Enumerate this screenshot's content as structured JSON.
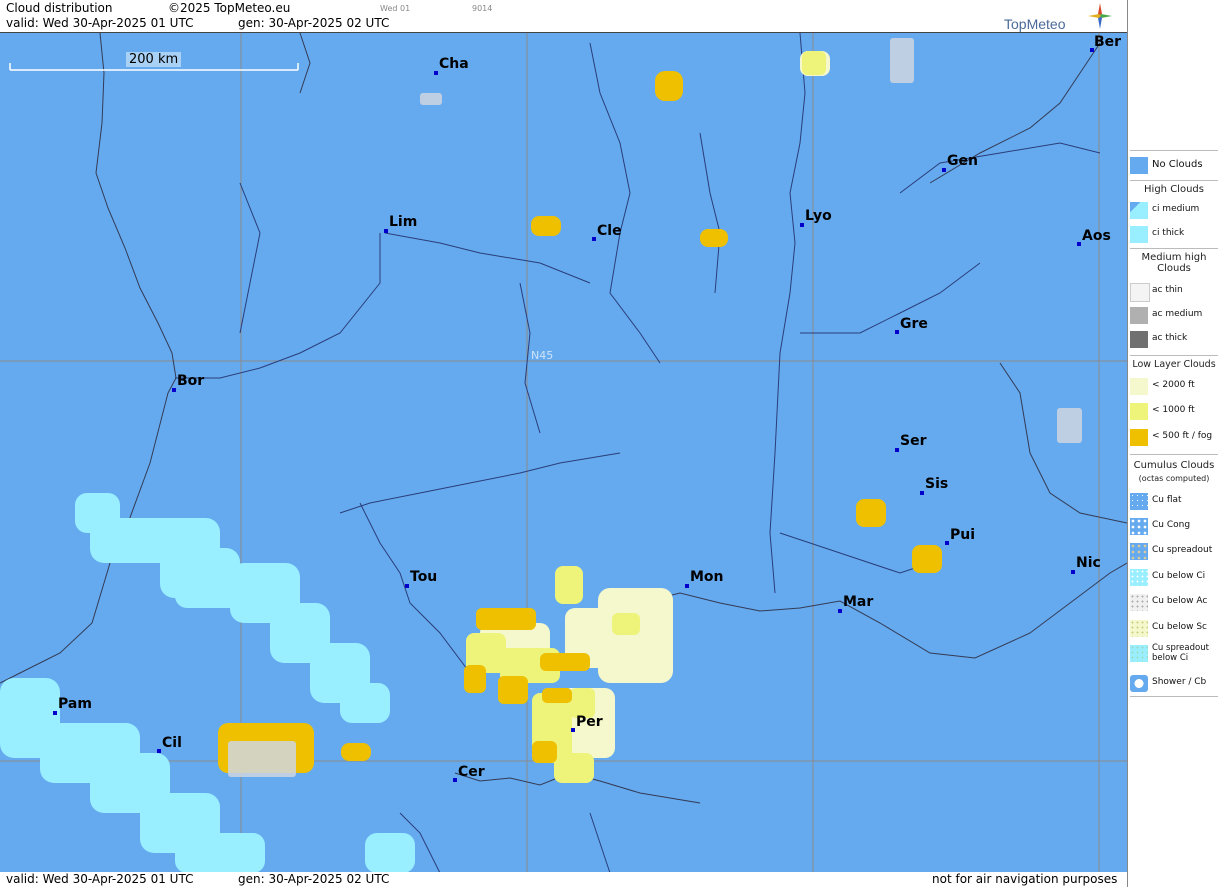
{
  "header": {
    "title": "Cloud distribution",
    "copyright": "©2025 TopMeteo.eu",
    "valid": "valid:  Wed  30-Apr-2025  01 UTC",
    "gen": "gen: 30-Apr-2025 02 UTC",
    "run_small": "Wed 01",
    "code_small": "9014",
    "logo": "TopMeteo"
  },
  "map": {
    "scale_label": "200 km",
    "lat_label": "N45",
    "cities": [
      {
        "id": "cha",
        "name": "Cha"
      },
      {
        "id": "ber",
        "name": "Ber"
      },
      {
        "id": "gen",
        "name": "Gen"
      },
      {
        "id": "lim",
        "name": "Lim"
      },
      {
        "id": "cle",
        "name": "Cle"
      },
      {
        "id": "lyo",
        "name": "Lyo"
      },
      {
        "id": "aos",
        "name": "Aos"
      },
      {
        "id": "gre",
        "name": "Gre"
      },
      {
        "id": "bor",
        "name": "Bor"
      },
      {
        "id": "ser",
        "name": "Ser"
      },
      {
        "id": "sis",
        "name": "Sis"
      },
      {
        "id": "pui",
        "name": "Pui"
      },
      {
        "id": "tou",
        "name": "Tou"
      },
      {
        "id": "mon",
        "name": "Mon"
      },
      {
        "id": "nic",
        "name": "Nic"
      },
      {
        "id": "mar",
        "name": "Mar"
      },
      {
        "id": "pam",
        "name": "Pam"
      },
      {
        "id": "per",
        "name": "Per"
      },
      {
        "id": "cil",
        "name": "Cil"
      },
      {
        "id": "cer",
        "name": "Cer"
      }
    ]
  },
  "footer": {
    "valid": "valid:  Wed  30-Apr-2025  01 UTC",
    "gen": "gen: 30-Apr-2025 02 UTC",
    "disclaimer": "not for air navigation purposes"
  },
  "legend": {
    "no_clouds": "No Clouds",
    "high_title": "High Clouds",
    "ci_medium": "ci medium",
    "ci_thick": "ci thick",
    "medium_title": "Medium high Clouds",
    "ac_thin": "ac thin",
    "ac_medium": "ac medium",
    "ac_thick": "ac thick",
    "low_title": "Low Layer Clouds",
    "low_2000": "< 2000 ft",
    "low_1000": "< 1000 ft",
    "low_500": "< 500 ft / fog",
    "cu_title": "Cumulus Clouds",
    "cu_sub": "(octas computed)",
    "cu_flat": "Cu flat",
    "cu_cong": "Cu Cong",
    "cu_spread": "Cu spreadout",
    "cu_below_ci": "Cu below Ci",
    "cu_below_ac": "Cu below Ac",
    "cu_below_sc": "Cu below Sc",
    "cu_spread_ci": "Cu spreadout below Ci",
    "shower": "Shower / Cb"
  },
  "colors": {
    "sea_land": "#65aaee",
    "ci": "#99eeff",
    "low2000": "#f4f8cc",
    "low1000": "#eef47a",
    "low500": "#eec000"
  }
}
